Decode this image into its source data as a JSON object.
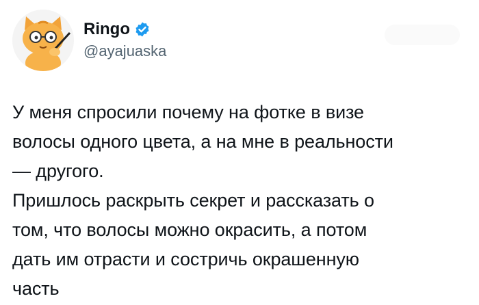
{
  "author": {
    "display_name": "Ringo",
    "handle": "@ayajuaska",
    "verified": true,
    "avatar_icon": "orange-cat-avatar",
    "verified_color": "#1d9bf0"
  },
  "tweet": {
    "paragraph_1": "У меня спросили почему на фотке в визе\nволосы одного цвета, а на мне в реальности\n— другого.",
    "paragraph_2": "Пришлось раскрыть секрет и рассказать о\nтом, что волосы можно окрасить, а потом\nдать им отрасти и состричь окрашенную\nчасть"
  }
}
